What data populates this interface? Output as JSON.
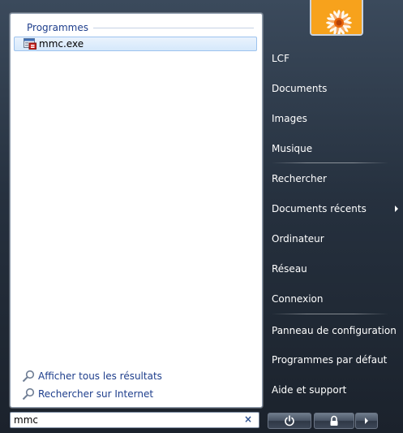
{
  "left": {
    "group_label": "Programmes",
    "results": [
      {
        "label": "mmc.exe",
        "icon": "mmc-app-icon"
      }
    ],
    "links": {
      "show_all": "Afficher tous les résultats",
      "search_internet": "Rechercher sur Internet"
    }
  },
  "search": {
    "value": "mmc",
    "clear_glyph": "×"
  },
  "right": {
    "items": [
      {
        "label": "LCF"
      },
      {
        "label": "Documents"
      },
      {
        "label": "Images"
      },
      {
        "label": "Musique"
      },
      {
        "label": "Rechercher"
      },
      {
        "label": "Documents récents"
      },
      {
        "label": "Ordinateur"
      },
      {
        "label": "Réseau"
      },
      {
        "label": "Connexion"
      },
      {
        "label": "Panneau de configuration"
      },
      {
        "label": "Programmes par défaut"
      },
      {
        "label": "Aide et support"
      }
    ]
  },
  "colors": {
    "accent": "#1e3e8c",
    "selection": "#d5e8fb",
    "user_picture": "#f59a18"
  }
}
